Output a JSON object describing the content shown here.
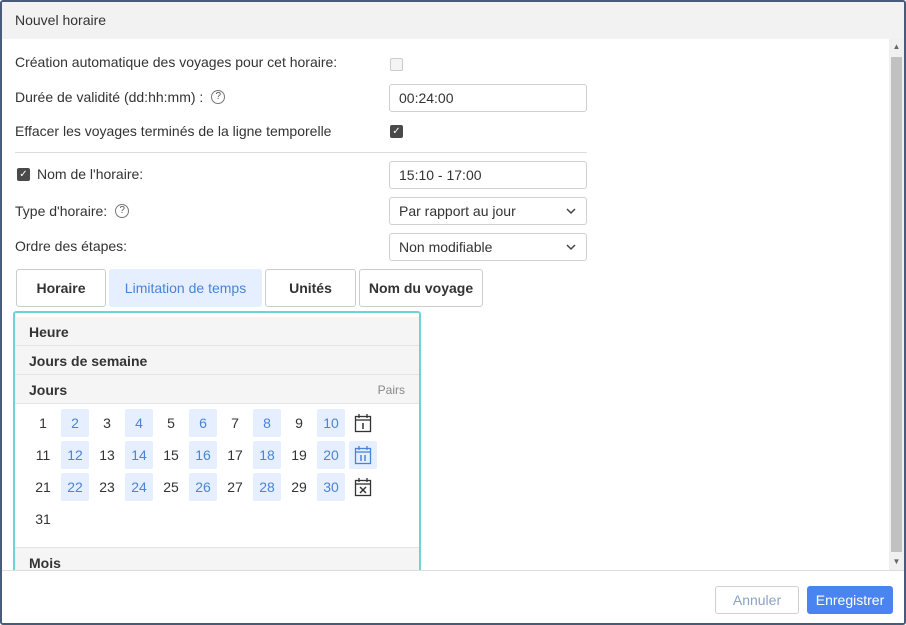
{
  "dialog": {
    "title": "Nouvel horaire"
  },
  "form": {
    "auto_create_label": "Création automatique des voyages pour cet horaire:",
    "validity_label": "Durée de validité (dd:hh:mm)  :",
    "validity_value": "00:24:00",
    "erase_label": "Effacer les voyages terminés de la ligne temporelle",
    "name_label": "Nom de l'horaire:",
    "name_value": "15:10 - 17:00",
    "type_label": "Type d'horaire:",
    "type_value": "Par rapport au jour",
    "order_label": "Ordre des étapes:",
    "order_value": "Non modifiable",
    "help_glyph": "?"
  },
  "tabs": [
    {
      "label": "Horaire"
    },
    {
      "label": "Limitation de temps"
    },
    {
      "label": "Unités"
    },
    {
      "label": "Nom du voyage"
    }
  ],
  "panel": {
    "heure": "Heure",
    "jours_semaine": "Jours de semaine",
    "jours": "Jours",
    "pairs": "Pairs",
    "mois": "Mois",
    "days": [
      "1",
      "2",
      "3",
      "4",
      "5",
      "6",
      "7",
      "8",
      "9",
      "10",
      "11",
      "12",
      "13",
      "14",
      "15",
      "16",
      "17",
      "18",
      "19",
      "20",
      "21",
      "22",
      "23",
      "24",
      "25",
      "26",
      "27",
      "28",
      "29",
      "30",
      "31"
    ],
    "selected_days": [
      "2",
      "4",
      "6",
      "8",
      "10",
      "12",
      "14",
      "16",
      "18",
      "20",
      "22",
      "24",
      "26",
      "28",
      "30"
    ]
  },
  "footer": {
    "cancel_label": "Annuler",
    "save_label": "Enregistrer"
  },
  "colors": {
    "accent": "#4a84f0",
    "selected_bg": "#e6efff",
    "selected_text": "#4a84d6",
    "panel_border": "#6fd3d6"
  }
}
